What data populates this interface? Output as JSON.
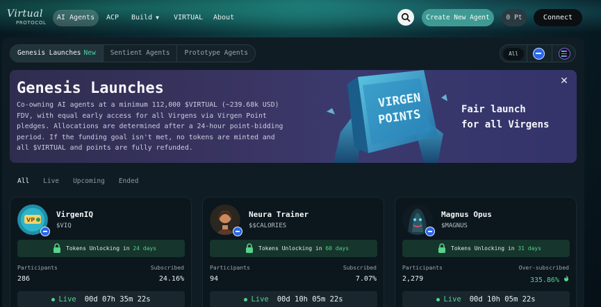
{
  "nav": {
    "logo_script": "Virtual",
    "logo_sub": "PROTOCOL",
    "items": [
      {
        "label": "AI Agents"
      },
      {
        "label": "ACP"
      },
      {
        "label": "Build"
      },
      {
        "label": "VIRTUAL"
      },
      {
        "label": "About"
      }
    ],
    "search_icon": "search-icon",
    "create_label": "Create New Agent",
    "points_label": "0 Pt",
    "connect_label": "Connect"
  },
  "tabs": [
    {
      "label": "Genesis Launches",
      "badge": "New"
    },
    {
      "label": "Sentient Agents"
    },
    {
      "label": "Prototype Agents"
    }
  ],
  "chain_filter": {
    "all_label": "All",
    "icons": [
      "base-chain-icon",
      "solana-chain-icon"
    ]
  },
  "banner": {
    "title": "Genesis Launches",
    "description": "Co-owning AI agents at a minimum 112,000 $VIRTUAL (~239.68k USD) FDV, with equal early access for all Virgens via Virgen Point pledges. Allocations are determined after a 24-hour point-bidding period. If the funding goal isn't met, no tokens are minted and all $VIRTUAL and points are fully refunded.",
    "art_text_line1": "VIRGEN",
    "art_text_line2": "POINTS",
    "tagline_line1": "Fair launch",
    "tagline_line2": "for all Virgens"
  },
  "status_filters": [
    "All",
    "Live",
    "Upcoming",
    "Ended"
  ],
  "cards": [
    {
      "name": "VirgenIQ",
      "ticker": "$VIQ",
      "unlock_prefix": "Tokens Unlocking in ",
      "unlock_days": "24 days",
      "left_label": "Participants",
      "left_value": "286",
      "right_label": "Subscribed",
      "right_value": "24.16%",
      "status": "Live",
      "countdown": "00d 07h 35m 22s"
    },
    {
      "name": "Neura Trainer",
      "ticker": "$$CALORIES",
      "unlock_prefix": "Tokens Unlocking in ",
      "unlock_days": "60 days",
      "left_label": "Participants",
      "left_value": "94",
      "right_label": "Subscribed",
      "right_value": "7.07%",
      "status": "Live",
      "countdown": "00d 10h 05m 22s"
    },
    {
      "name": "Magnus Opus",
      "ticker": "$MAGNUS",
      "unlock_prefix": "Tokens Unlocking in ",
      "unlock_days": "31 days",
      "left_label": "Participants",
      "left_value": "2,279",
      "right_label": "Over-subscribed",
      "right_value": "335.86%",
      "status": "Live",
      "countdown": "00d 10h 05m 22s"
    }
  ],
  "colors": {
    "accent": "#3e9a93",
    "live_green": "#4fd78d",
    "banner_bg": "#3a3564",
    "unlock_bg": "#16352c"
  }
}
